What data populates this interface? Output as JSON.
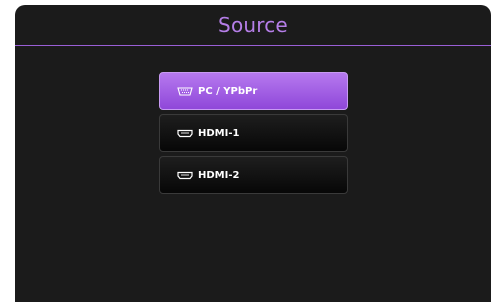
{
  "window": {
    "title": "Source"
  },
  "sources": [
    {
      "label": "PC / YPbPr",
      "icon": "vga-port-icon",
      "selected": true
    },
    {
      "label": "HDMI-1",
      "icon": "hdmi-port-icon",
      "selected": false
    },
    {
      "label": "HDMI-2",
      "icon": "hdmi-port-icon",
      "selected": false
    }
  ],
  "colors": {
    "accent": "#b57ee8",
    "selected_bg": "#a564e6",
    "panel_bg": "#1b1b1b"
  }
}
